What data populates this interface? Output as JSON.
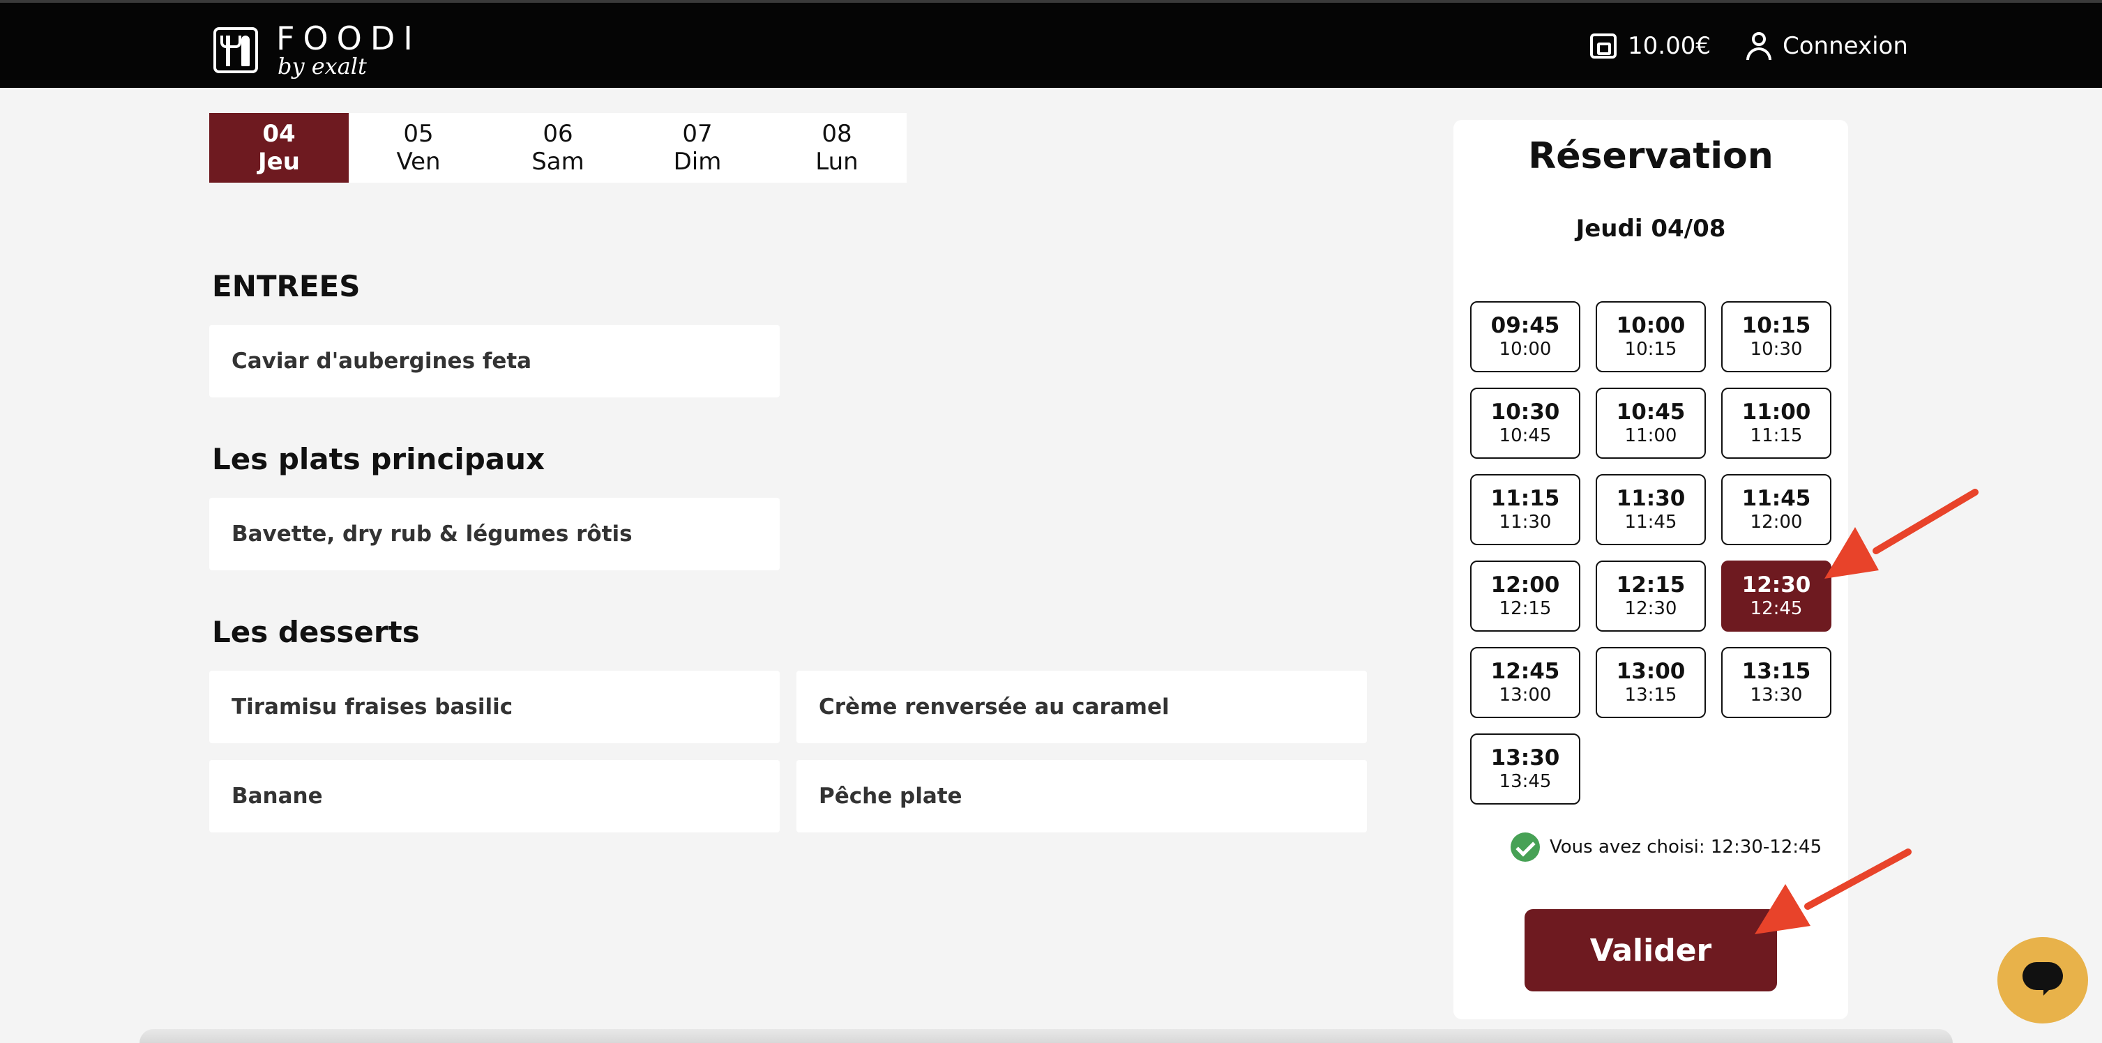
{
  "brand": {
    "name": "FOODI",
    "tagline": "by exalt"
  },
  "header": {
    "wallet_balance": "10.00€",
    "login_label": "Connexion"
  },
  "days": [
    {
      "num": "04",
      "label": "Jeu",
      "active": true
    },
    {
      "num": "05",
      "label": "Ven",
      "active": false
    },
    {
      "num": "06",
      "label": "Sam",
      "active": false
    },
    {
      "num": "07",
      "label": "Dim",
      "active": false
    },
    {
      "num": "08",
      "label": "Lun",
      "active": false
    }
  ],
  "menu": {
    "entrees": {
      "title": "ENTREES",
      "items": [
        "Caviar d'aubergines feta"
      ]
    },
    "mains": {
      "title": "Les plats principaux",
      "items": [
        "Bavette, dry rub & légumes rôtis"
      ]
    },
    "desserts": {
      "title": "Les desserts",
      "items": [
        "Tiramisu fraises basilic",
        "Crème renversée au caramel",
        "Banane",
        "Pêche plate"
      ]
    }
  },
  "reservation": {
    "title": "Réservation",
    "date": "Jeudi 04/08",
    "slots": [
      {
        "start": "09:45",
        "end": "10:00"
      },
      {
        "start": "10:00",
        "end": "10:15"
      },
      {
        "start": "10:15",
        "end": "10:30"
      },
      {
        "start": "10:30",
        "end": "10:45"
      },
      {
        "start": "10:45",
        "end": "11:00"
      },
      {
        "start": "11:00",
        "end": "11:15"
      },
      {
        "start": "11:15",
        "end": "11:30"
      },
      {
        "start": "11:30",
        "end": "11:45"
      },
      {
        "start": "11:45",
        "end": "12:00"
      },
      {
        "start": "12:00",
        "end": "12:15"
      },
      {
        "start": "12:15",
        "end": "12:30"
      },
      {
        "start": "12:30",
        "end": "12:45",
        "selected": true
      },
      {
        "start": "12:45",
        "end": "13:00"
      },
      {
        "start": "13:00",
        "end": "13:15"
      },
      {
        "start": "13:15",
        "end": "13:30"
      },
      {
        "start": "13:30",
        "end": "13:45"
      }
    ],
    "chosen_text": "Vous avez choisi: 12:30-12:45",
    "validate_label": "Valider"
  },
  "colors": {
    "accent": "#6e1a20",
    "topbar": "#050505",
    "success": "#47a155",
    "chat": "#e8b24a",
    "annotation_arrow": "#e8432a"
  },
  "icons": {
    "wallet": "wallet-icon",
    "user": "user-icon",
    "check": "check-circle-icon",
    "chat": "chat-bubble-icon"
  }
}
